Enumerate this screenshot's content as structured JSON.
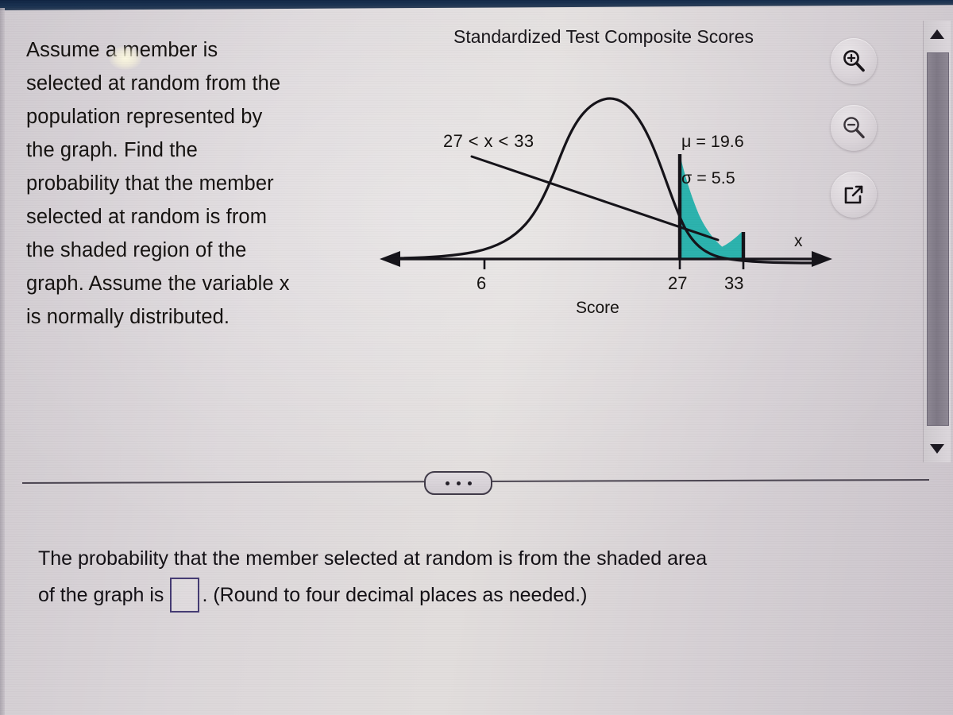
{
  "problem": {
    "prompt": "Assume a member is selected at random from the population represented by the graph. Find the probability that the member selected at random is from the shaded region of the graph. Assume the variable x is normally distributed."
  },
  "figure": {
    "title": "Standardized Test Composite Scores",
    "range_label": "27 < x < 33",
    "mu_label": "μ = 19.6",
    "sigma_label": "σ = 5.5",
    "axis_variable": "x",
    "axis_title": "Score",
    "ticks": [
      "6",
      "27",
      "33"
    ],
    "shade_color": "#2BB2AD",
    "curve_color": "#141218"
  },
  "chart_data": {
    "type": "area",
    "title": "Standardized Test Composite Scores",
    "xlabel": "Score",
    "ylabel": "",
    "axis_variable": "x",
    "distribution": "normal",
    "mu": 19.6,
    "sigma": 5.5,
    "tick_values": [
      6,
      27,
      33
    ],
    "tick_labels": [
      "6",
      "27",
      "33"
    ],
    "shaded_interval": [
      27,
      33
    ],
    "shaded_interval_label": "27 < x < 33",
    "shade_color": "#2BB2AD",
    "grid": false,
    "legend": "none",
    "annotations": [
      "27 < x < 33",
      "μ = 19.6",
      "σ = 5.5"
    ]
  },
  "tools": {
    "zoom_in": "zoom-in-icon",
    "zoom_out": "zoom-out-icon",
    "open_external": "open-in-new-window-icon"
  },
  "scrollbar": {
    "up": "scroll-up-arrow",
    "down": "scroll-down-arrow"
  },
  "divider": {
    "more_label": "more-options-ellipsis"
  },
  "answer": {
    "line1": "The probability that the member selected at random is from the shaded area",
    "line2_prefix": "of the graph is",
    "value": "",
    "line2_suffix": ". (Round to four decimal places as needed.)"
  },
  "colors": {
    "accent_shade": "#2BB2AD",
    "input_border": "#443a72",
    "top_band": "#18304f",
    "background": "#d6d0d6"
  }
}
